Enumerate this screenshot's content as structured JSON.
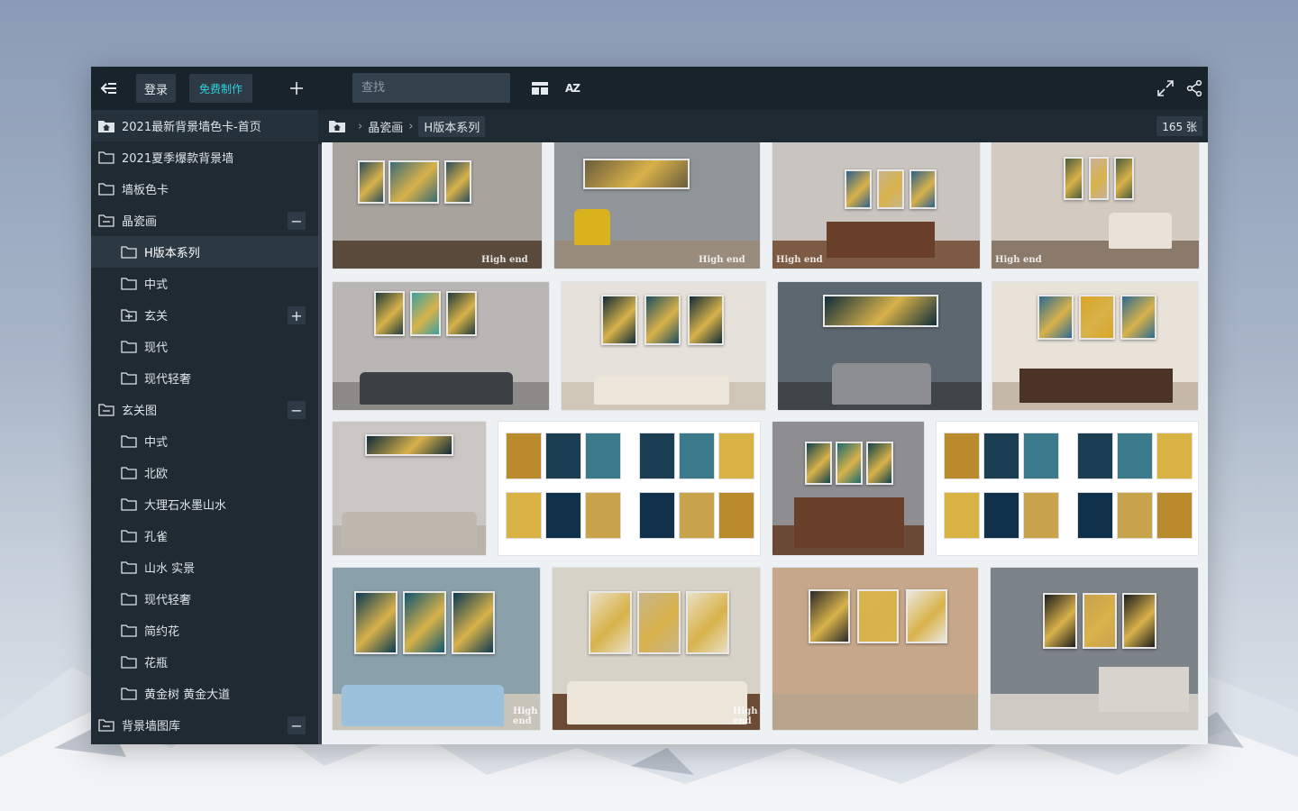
{
  "topbar": {
    "login_label": "登录",
    "free_make_label": "免费制作",
    "search_placeholder": "查找",
    "sort_label": "AZ"
  },
  "sidebar": {
    "items": [
      {
        "label": "2021最新背景墙色卡-首页",
        "level": 0,
        "icon": "home-folder-icon"
      },
      {
        "label": "2021夏季爆款背景墙",
        "level": 0,
        "icon": "folder-icon"
      },
      {
        "label": "墙板色卡",
        "level": 0,
        "icon": "folder-icon"
      },
      {
        "label": "晶瓷画",
        "level": 0,
        "icon": "folder-open-icon",
        "toggle": "−"
      },
      {
        "label": "H版本系列",
        "level": 1,
        "icon": "folder-icon",
        "active": true
      },
      {
        "label": "中式",
        "level": 1,
        "icon": "folder-icon"
      },
      {
        "label": "玄关",
        "level": 1,
        "icon": "folder-plus-icon",
        "toggle": "+"
      },
      {
        "label": "现代",
        "level": 1,
        "icon": "folder-icon"
      },
      {
        "label": "现代轻奢",
        "level": 1,
        "icon": "folder-icon"
      },
      {
        "label": "玄关图",
        "level": 0,
        "icon": "folder-open-icon",
        "toggle": "−"
      },
      {
        "label": "中式",
        "level": 1,
        "icon": "folder-icon"
      },
      {
        "label": "北欧",
        "level": 1,
        "icon": "folder-icon"
      },
      {
        "label": "大理石水墨山水",
        "level": 1,
        "icon": "folder-icon"
      },
      {
        "label": "孔雀",
        "level": 1,
        "icon": "folder-icon"
      },
      {
        "label": "山水 实景",
        "level": 1,
        "icon": "folder-icon"
      },
      {
        "label": "现代轻奢",
        "level": 1,
        "icon": "folder-icon"
      },
      {
        "label": "简约花",
        "level": 1,
        "icon": "folder-icon"
      },
      {
        "label": "花瓶",
        "level": 1,
        "icon": "folder-icon"
      },
      {
        "label": "黄金树 黄金大道",
        "level": 1,
        "icon": "folder-icon"
      },
      {
        "label": "背景墙图库",
        "level": 0,
        "icon": "folder-open-icon",
        "toggle": "−"
      }
    ]
  },
  "breadcrumb": {
    "items": [
      "晶瓷画",
      "H版本系列"
    ],
    "separator": "›"
  },
  "count_label": "165 张",
  "watermark": "High end",
  "colors": {
    "accent": "#2fd2dd",
    "topbar": "#19232b",
    "sidebar": "#1f2a33",
    "content_bg": "#eef1f4"
  }
}
